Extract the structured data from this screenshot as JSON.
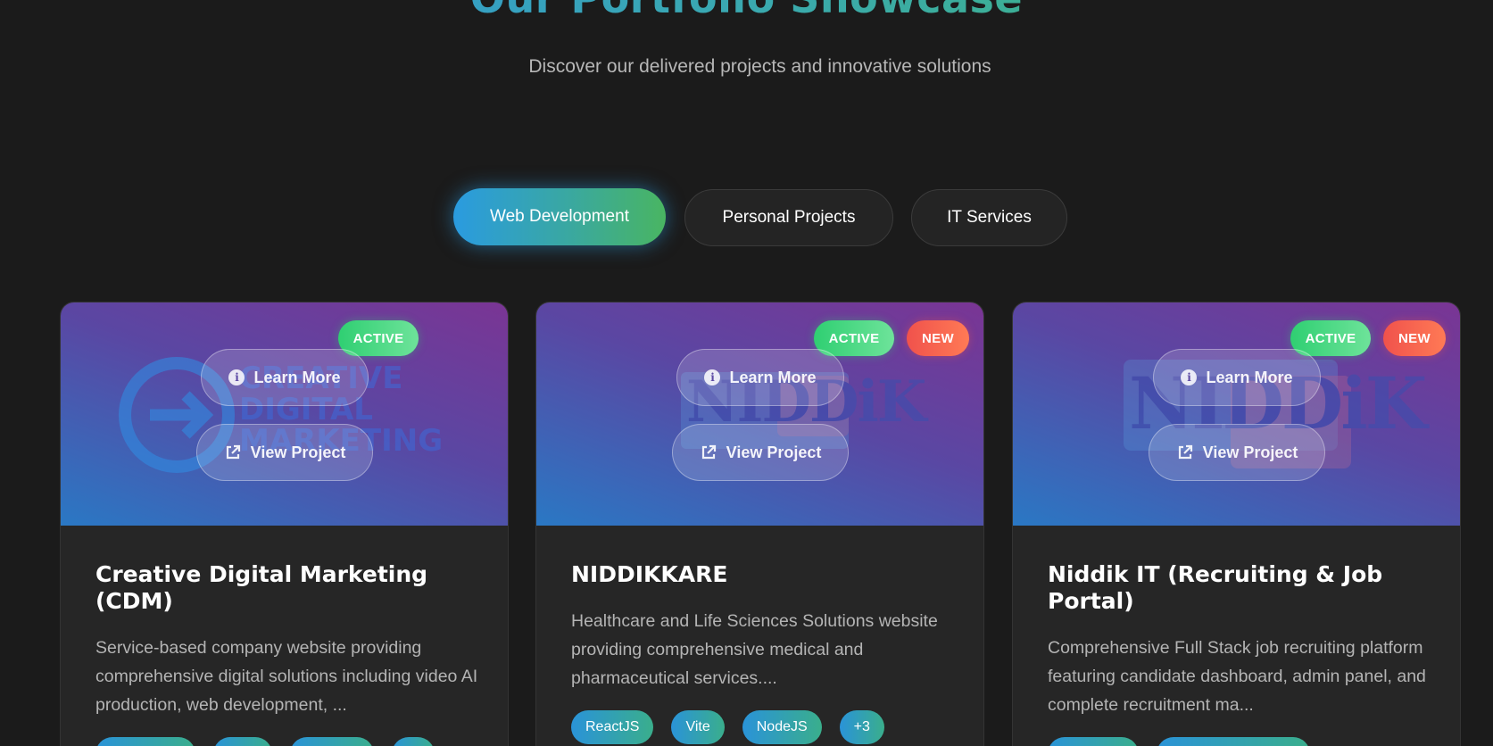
{
  "header": {
    "title": "Our Portfolio Showcase",
    "subtitle": "Discover our delivered projects and innovative solutions"
  },
  "tabs": [
    {
      "label": "Web Development",
      "active": true
    },
    {
      "label": "Personal Projects",
      "active": false
    },
    {
      "label": "IT Services",
      "active": false
    }
  ],
  "overlay": {
    "learn_more": "Learn More",
    "view_project": "View Project"
  },
  "cards": [
    {
      "title": "Creative Digital Marketing (CDM)",
      "description": "Service-based company website providing comprehensive digital solutions including video AI production, web development, ...",
      "badges": [
        "ACTIVE"
      ],
      "logo_text": [
        "CREATIVE",
        "DIGITAL",
        "MARKETING"
      ]
    },
    {
      "title": "NIDDIKKARE",
      "description": "Healthcare and Life Sciences Solutions website providing comprehensive medical and pharmaceutical services....",
      "badges": [
        "ACTIVE",
        "NEW"
      ],
      "logo_text": [
        "NIDDiK"
      ],
      "tags": [
        "ReactJS",
        "Vite",
        "NodeJS",
        "+3"
      ]
    },
    {
      "title": "Niddik IT (Recruiting & Job Portal)",
      "description": "Comprehensive Full Stack job recruiting platform featuring candidate dashboard, admin panel, and complete recruitment ma...",
      "badges": [
        "ACTIVE",
        "NEW"
      ],
      "logo_text": [
        "NIDDiK"
      ]
    }
  ],
  "colors": {
    "background": "#1b1b1b",
    "card": "#262626",
    "accent_blue": "#2a9be0",
    "accent_green": "#49b562",
    "badge_active": "#2fcf72",
    "badge_new": "#f0524c"
  }
}
